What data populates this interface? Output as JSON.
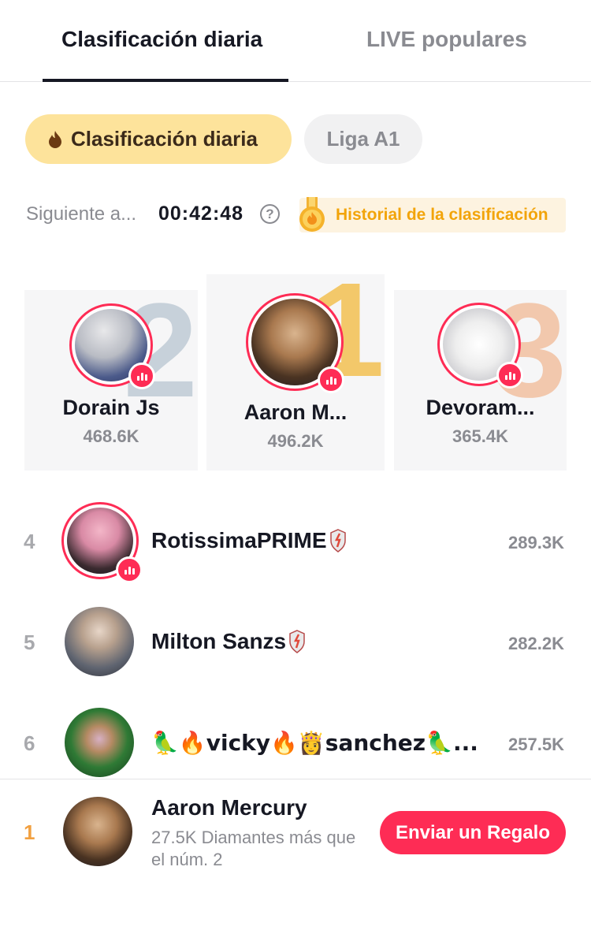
{
  "tabs": {
    "daily": "Clasificación diaria",
    "live": "LIVE populares"
  },
  "chips": {
    "active": "Clasificación diaria",
    "inactive": "Liga A1"
  },
  "countdown": {
    "label": "Siguiente a...",
    "time": "00:42:48",
    "help": "?"
  },
  "history": {
    "label": "Historial de la clasificación"
  },
  "podium": [
    {
      "rank_numeral": "2",
      "name": "Dorain Js",
      "score": "468.6K",
      "number_color": "#c7d1da"
    },
    {
      "rank_numeral": "1",
      "name": "Aaron M...",
      "score": "496.2K",
      "number_color": "#f3c86a"
    },
    {
      "rank_numeral": "3",
      "name": "Devoram...",
      "score": "365.4K",
      "number_color": "#f2c8ad"
    }
  ],
  "list": [
    {
      "rank": "4",
      "name": "RotissimaPRIME",
      "score": "289.3K",
      "live": true
    },
    {
      "rank": "5",
      "name": "Milton Sanzs",
      "score": "282.2K",
      "live": false
    },
    {
      "rank": "6",
      "name": "🦜🔥vicky🔥👸sanchez🦜...",
      "score": "257.5K",
      "live": false
    }
  ],
  "bottom": {
    "rank": "1",
    "name": "Aaron Mercury",
    "desc": "27.5K Diamantes más que el núm. 2",
    "button": "Enviar un Regalo"
  },
  "colors": {
    "accent": "#fe2c55",
    "chip_active_bg": "#fde39b",
    "history_text": "#f2a40a",
    "rank_gold": "#f2a040"
  }
}
